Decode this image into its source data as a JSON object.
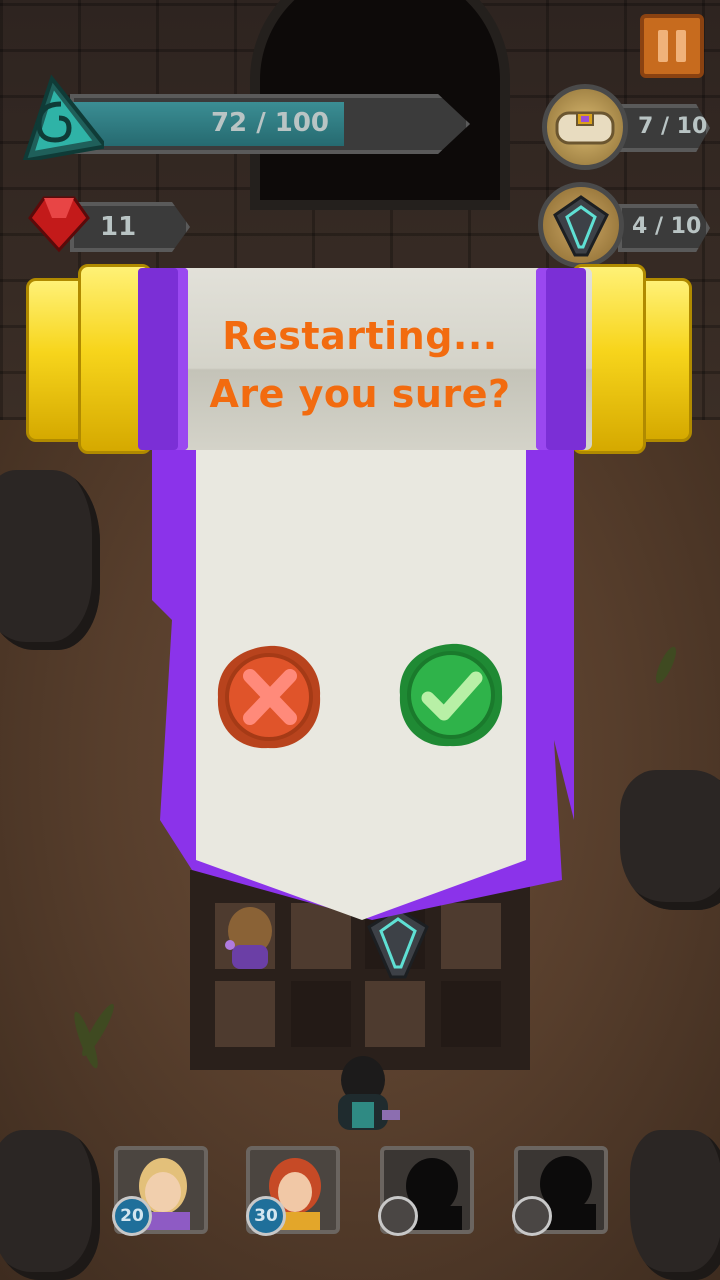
{
  "hud": {
    "health_text": "72 / 100",
    "health_fraction": 0.72,
    "gems": "11",
    "scrolls_text": "7 / 10",
    "crystals_text": "4 / 10"
  },
  "dialog": {
    "title_line1": "Restarting...",
    "title_line2": "Are you sure?"
  },
  "heroes": [
    {
      "level": "20",
      "locked": false
    },
    {
      "level": "30",
      "locked": false
    },
    {
      "level": "",
      "locked": true
    },
    {
      "level": "",
      "locked": true
    }
  ],
  "colors": {
    "title": "#f26b0f",
    "banner_purple": "#7b2fd6",
    "cancel": "#e0542a",
    "confirm": "#2fb34a",
    "health_fill": "#2f7e84"
  },
  "icons": {
    "health": "teal-spiral-gem-icon",
    "gem": "red-ruby-icon",
    "scroll": "scroll-icon",
    "crystal": "crystal-icon",
    "pause": "pause-icon",
    "cancel": "x-icon",
    "confirm": "check-icon"
  }
}
